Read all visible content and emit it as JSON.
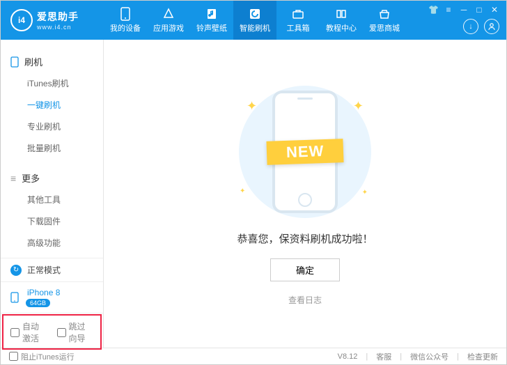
{
  "brand": {
    "name": "爱思助手",
    "site": "www.i4.cn",
    "logo_text": "i4"
  },
  "topnav": [
    {
      "label": "我的设备",
      "active": false
    },
    {
      "label": "应用游戏",
      "active": false
    },
    {
      "label": "铃声壁纸",
      "active": false
    },
    {
      "label": "智能刷机",
      "active": true
    },
    {
      "label": "工具箱",
      "active": false
    },
    {
      "label": "教程中心",
      "active": false
    },
    {
      "label": "爱思商城",
      "active": false
    }
  ],
  "sidebar": {
    "sections": [
      {
        "title": "刷机",
        "icon": "phone",
        "items": [
          {
            "label": "iTunes刷机",
            "active": false
          },
          {
            "label": "一键刷机",
            "active": true
          },
          {
            "label": "专业刷机",
            "active": false
          },
          {
            "label": "批量刷机",
            "active": false
          }
        ]
      },
      {
        "title": "更多",
        "icon": "list",
        "items": [
          {
            "label": "其他工具",
            "active": false
          },
          {
            "label": "下载固件",
            "active": false
          },
          {
            "label": "高级功能",
            "active": false
          }
        ]
      }
    ],
    "mode": "正常模式",
    "device": {
      "name": "iPhone 8",
      "badge": "64GB"
    },
    "checkboxes": {
      "auto_activate": "自动激活",
      "skip_guide": "跳过向导"
    }
  },
  "main": {
    "banner": "NEW",
    "success_text": "恭喜您，保资料刷机成功啦！",
    "ok_button": "确定",
    "view_log": "查看日志"
  },
  "footer": {
    "block_itunes": "阻止iTunes运行",
    "version": "V8.12",
    "links": [
      "客服",
      "微信公众号",
      "检查更新"
    ]
  }
}
